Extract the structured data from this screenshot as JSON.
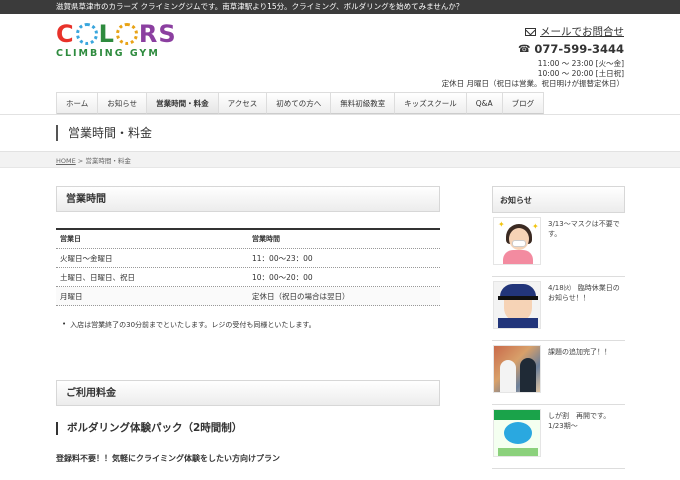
{
  "topbar": {
    "text": "滋賀県草津市のカラーズ クライミングジムです。南草津駅より15分。クライミング、ボルダリングを始めてみませんか？"
  },
  "logo": {
    "text": "COLORS",
    "subtitle": "CLIMBING GYM",
    "colors": [
      "#e8322a",
      "#3aa6dd",
      "#e8a317",
      "#2e8b3e",
      "#8b3fa0"
    ]
  },
  "contact": {
    "mail_label": "メールでお問合せ",
    "phone": "077-599-3444",
    "hours": [
      "11:00 ～ 23:00 [火～金]",
      "10:00 ～ 20:00 [土日祝]",
      "定休日 月曜日（祝日は営業。祝日明けが振替定休日）"
    ]
  },
  "nav": {
    "items": [
      "ホーム",
      "お知らせ",
      "営業時間・料金",
      "アクセス",
      "初めての方へ",
      "無料初級教室",
      "キッズスクール",
      "Q&A",
      "ブログ"
    ],
    "active": "営業時間・料金"
  },
  "page": {
    "title": "営業時間・料金"
  },
  "breadcrumb": {
    "home": "HOME",
    "separator": " > ",
    "current": "営業時間・料金"
  },
  "main": {
    "hours_title": "営業時間",
    "table": {
      "headers": [
        "営業日",
        "営業時間"
      ],
      "rows": [
        [
          "火曜日～金曜日",
          "11：00～23：00"
        ],
        [
          "土曜日、日曜日、祝日",
          "10：00～20：00"
        ],
        [
          "月曜日",
          "定休日（祝日の場合は翌日）"
        ]
      ]
    },
    "note": "入店は営業終了の30分前までといたします。レジの受付も同様といたします。",
    "fee_title": "ご利用料金",
    "package_heading": "ボルダリング体験パック（2時間制）",
    "lead": "登録料不要！！気軽にクライミング体験をしたい方向けプラン"
  },
  "sidebar": {
    "title": "お知らせ",
    "news": [
      {
        "text": "3/13～マスクは不要です。"
      },
      {
        "text": "4/18㈫　臨時休業日のお知らせ！！"
      },
      {
        "text": "課題の追加完了！！"
      },
      {
        "text": "しが割　再開です。1/23期～"
      }
    ]
  }
}
